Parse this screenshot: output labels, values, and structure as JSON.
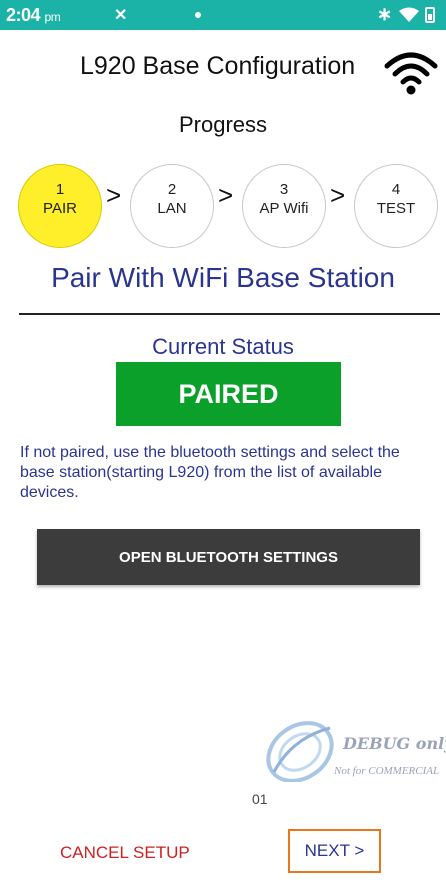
{
  "status_bar": {
    "time": "2:04",
    "ampm": "pm"
  },
  "header": {
    "title": "L920 Base Configuration",
    "wifi_icon": "wifi-icon"
  },
  "progress": {
    "label": "Progress",
    "separator": ">",
    "steps": [
      {
        "number": "1",
        "label": "PAIR",
        "active": true
      },
      {
        "number": "2",
        "label": "LAN",
        "active": false
      },
      {
        "number": "3",
        "label": "AP Wifi",
        "active": false
      },
      {
        "number": "4",
        "label": "TEST",
        "active": false
      }
    ]
  },
  "pair_section": {
    "heading": "Pair With WiFi Base Station",
    "current_status_label": "Current Status",
    "status_value": "PAIRED",
    "instructions": "If not paired, use the bluetooth settings and select the base station(starting L920) from the list of available devices.",
    "open_bluetooth_button": "OPEN BLUETOOTH SETTINGS"
  },
  "watermark": {
    "text": "DEBUG only",
    "sub": "Not for COMMERCIAL"
  },
  "page_number": "01",
  "footer": {
    "cancel_label": "CANCEL SETUP",
    "next_label": "NEXT >"
  },
  "colors": {
    "status_bar": "#1bb3a8",
    "active_step": "#ffef2a",
    "heading_blue": "#2b3590",
    "paired_green": "#0aa02a",
    "button_dark": "#3c3c3c",
    "cancel_red": "#cc2222",
    "next_border": "#e8761d"
  }
}
